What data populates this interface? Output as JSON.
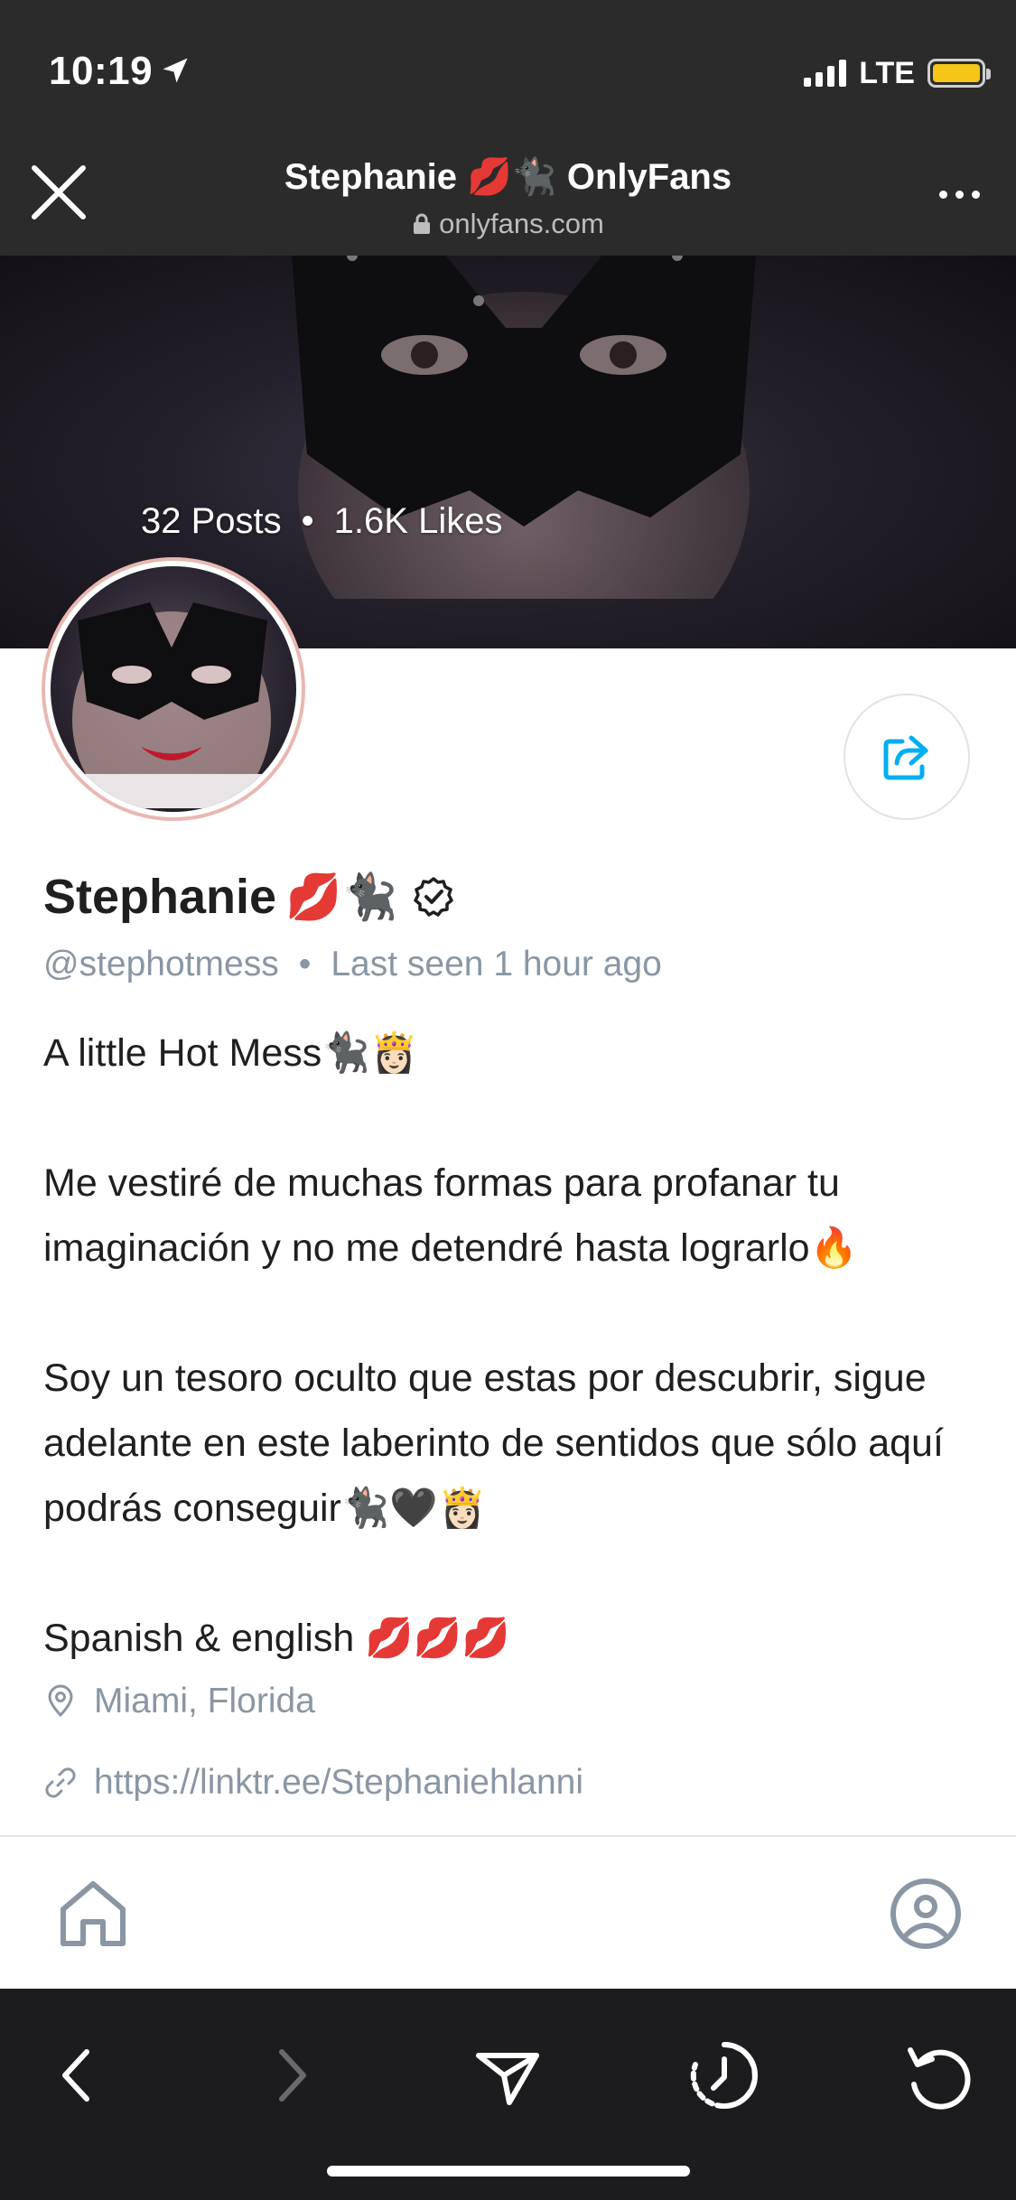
{
  "status_bar": {
    "time": "10:19",
    "network": "LTE"
  },
  "browser": {
    "title": "Stephanie 💋🐈‍⬛ OnlyFans",
    "url": "onlyfans.com"
  },
  "cover": {
    "posts": "32 Posts",
    "dot": "•",
    "likes": "1.6K Likes"
  },
  "profile": {
    "name": "Stephanie",
    "name_emoji": "💋🐈‍⬛",
    "username": "@stephotmess",
    "meta_sep": "•",
    "last_seen": "Last seen 1 hour ago",
    "bio": [
      "A little Hot Mess🐈‍⬛👸🏻",
      "",
      "Me vestiré de muchas formas para profanar tu imaginación y no me detendré hasta lograrlo🔥",
      "",
      "Soy un tesoro oculto que estas por descubrir, sigue adelante en este laberinto de sentidos que sólo aquí podrás conseguir🐈‍⬛🖤👸🏻",
      "",
      "Spanish & english 💋💋💋"
    ],
    "location": "Miami, Florida",
    "link": "https://linktr.ee/Stephaniehlanni"
  },
  "icons": {
    "accent": "#00aff0",
    "muted": "#8a96a3"
  }
}
